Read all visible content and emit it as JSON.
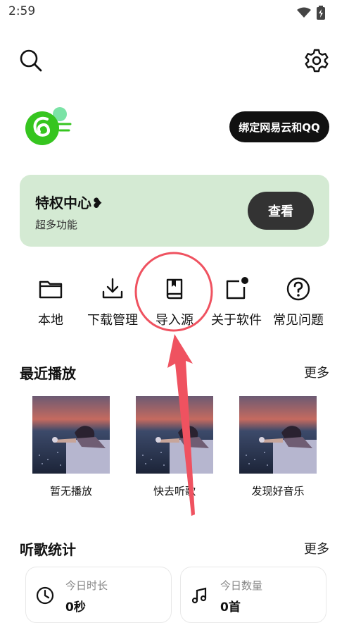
{
  "status_bar": {
    "time": "2:59"
  },
  "header": {
    "search_icon": "search-icon",
    "settings_icon": "gear-icon"
  },
  "profile": {
    "bind_button": "绑定网易云和QQ"
  },
  "vip": {
    "title": "特权中心❥",
    "subtitle": "超多功能",
    "button": "查看"
  },
  "quick_actions": [
    {
      "label": "本地",
      "icon": "folder-icon"
    },
    {
      "label": "下载管理",
      "icon": "download-icon"
    },
    {
      "label": "导入源",
      "icon": "book-icon"
    },
    {
      "label": "关于软件",
      "icon": "notification-square-icon"
    },
    {
      "label": "常见问题",
      "icon": "question-icon"
    }
  ],
  "recent": {
    "title": "最近播放",
    "more": "更多",
    "items": [
      {
        "caption": "暂无播放"
      },
      {
        "caption": "快去听歌"
      },
      {
        "caption": "发现好音乐"
      }
    ]
  },
  "stats": {
    "title": "听歌统计",
    "more": "更多",
    "items": [
      {
        "label": "今日时长",
        "value": "0秒",
        "icon": "clock-icon"
      },
      {
        "label": "今日数量",
        "value": "0首",
        "icon": "music-note-icon"
      }
    ]
  },
  "colors": {
    "vip_bg": "#d4ead3",
    "annotation": "#ef5260",
    "logo_green": "#36c51f"
  }
}
